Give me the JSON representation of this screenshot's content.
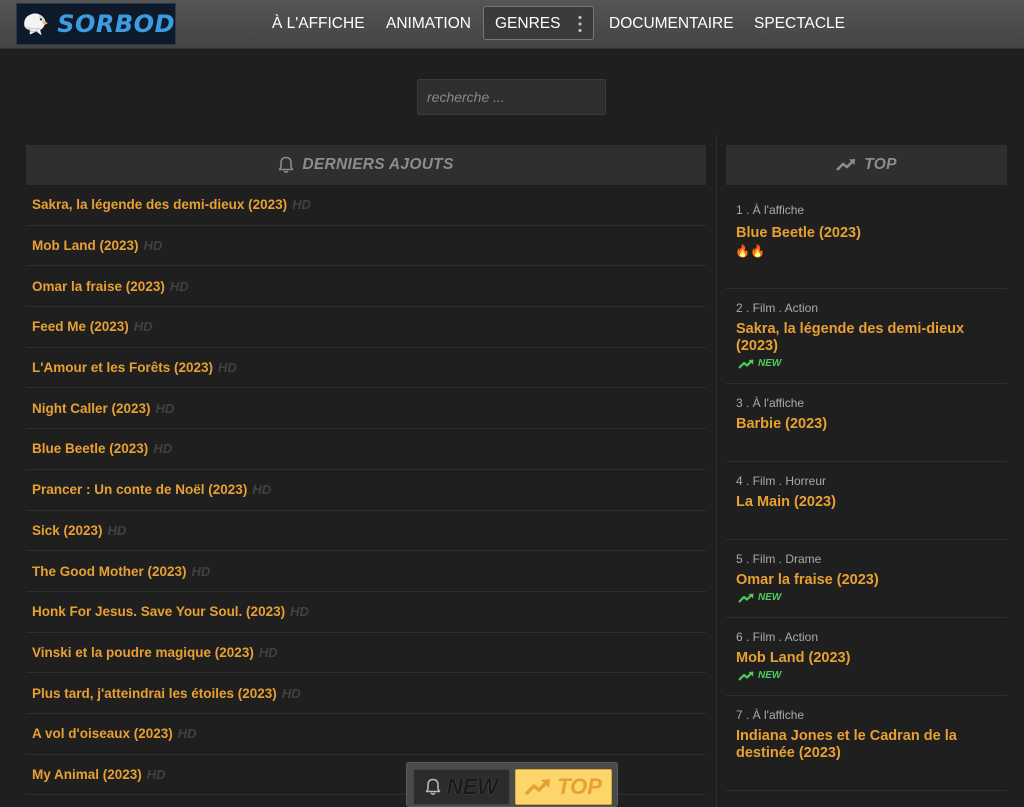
{
  "site": {
    "logo_text": "SORBOD"
  },
  "nav": {
    "items": [
      "À L'AFFICHE",
      "ANIMATION",
      "GENRES",
      "DOCUMENTAIRE",
      "SPECTACLE"
    ]
  },
  "search": {
    "placeholder": "recherche ..."
  },
  "latest": {
    "heading": "DERNIERS AJOUTS",
    "items": [
      {
        "title": "Sakra, la légende des demi-dieux (2023)",
        "quality": "HD"
      },
      {
        "title": "Mob Land (2023)",
        "quality": "HD"
      },
      {
        "title": "Omar la fraise (2023)",
        "quality": "HD"
      },
      {
        "title": "Feed Me (2023)",
        "quality": "HD"
      },
      {
        "title": "L'Amour et les Forêts (2023)",
        "quality": "HD"
      },
      {
        "title": "Night Caller (2023)",
        "quality": "HD"
      },
      {
        "title": "Blue Beetle (2023)",
        "quality": "HD"
      },
      {
        "title": "Prancer : Un conte de Noël (2023)",
        "quality": "HD"
      },
      {
        "title": "Sick (2023)",
        "quality": "HD"
      },
      {
        "title": "The Good Mother (2023)",
        "quality": "HD"
      },
      {
        "title": "Honk For Jesus. Save Your Soul. (2023)",
        "quality": "HD"
      },
      {
        "title": "Vinski et la poudre magique (2023)",
        "quality": "HD"
      },
      {
        "title": "Plus tard, j'atteindrai les étoiles (2023)",
        "quality": "HD"
      },
      {
        "title": "A vol d'oiseaux (2023)",
        "quality": "HD"
      },
      {
        "title": "My Animal (2023)",
        "quality": "HD"
      }
    ]
  },
  "top": {
    "heading": "TOP",
    "items": [
      {
        "meta": "1 . À l'affiche",
        "title": "Blue Beetle (2023)",
        "badge": "🔥🔥",
        "badge_type": "fire"
      },
      {
        "meta": "2 . Film . Action",
        "title": "Sakra, la légende des demi-dieux (2023)",
        "badge": "NEW",
        "badge_type": "new"
      },
      {
        "meta": "3 . À l'affiche",
        "title": "Barbie (2023)",
        "badge": "",
        "badge_type": ""
      },
      {
        "meta": "4 . Film . Horreur",
        "title": "La Main (2023)",
        "badge": "",
        "badge_type": ""
      },
      {
        "meta": "5 . Film . Drame",
        "title": "Omar la fraise (2023)",
        "badge": "NEW",
        "badge_type": "new"
      },
      {
        "meta": "6 . Film . Action",
        "title": "Mob Land (2023)",
        "badge": "NEW",
        "badge_type": "new"
      },
      {
        "meta": "7 . À l'affiche",
        "title": "Indiana Jones et le Cadran de la destinée (2023)",
        "badge": "",
        "badge_type": ""
      }
    ]
  },
  "float_bar": {
    "new_label": "NEW",
    "top_label": "TOP"
  },
  "colors": {
    "accent": "#e8a033",
    "new_badge": "#4ecb5c",
    "logo_text": "#3d9be4"
  }
}
